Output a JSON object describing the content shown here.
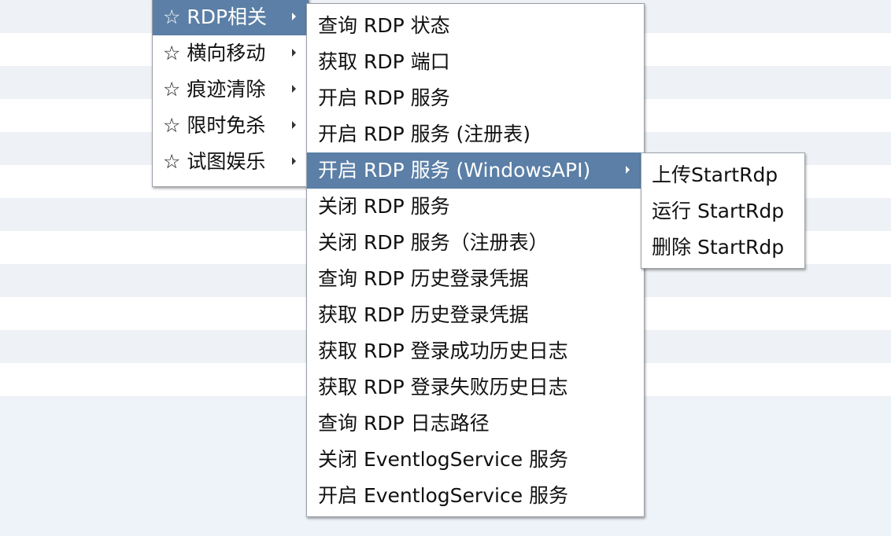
{
  "main_menu": {
    "items": [
      {
        "label": "☆ RDP相关",
        "selected": true
      },
      {
        "label": "☆ 横向移动"
      },
      {
        "label": "☆ 痕迹清除"
      },
      {
        "label": "☆ 限时免杀"
      },
      {
        "label": "☆ 试图娱乐"
      }
    ]
  },
  "rdp_menu": {
    "items": [
      {
        "label": "查询 RDP 状态"
      },
      {
        "label": "获取 RDP 端口"
      },
      {
        "label": "开启 RDP 服务"
      },
      {
        "label": "开启 RDP 服务 (注册表)"
      },
      {
        "label": "开启 RDP 服务 (WindowsAPI)",
        "selected": true
      },
      {
        "label": "关闭 RDP 服务"
      },
      {
        "label": "关闭 RDP 服务（注册表）"
      },
      {
        "label": "查询 RDP 历史登录凭据"
      },
      {
        "label": "获取 RDP 历史登录凭据"
      },
      {
        "label": "获取 RDP 登录成功历史日志"
      },
      {
        "label": "获取 RDP 登录失败历史日志"
      },
      {
        "label": "查询 RDP 日志路径"
      },
      {
        "label": "关闭 EventlogService 服务"
      },
      {
        "label": "开启 EventlogService 服务"
      }
    ]
  },
  "startrdp_menu": {
    "items": [
      {
        "label": "上传StartRdp"
      },
      {
        "label": "运行 StartRdp"
      },
      {
        "label": "删除 StartRdp"
      }
    ]
  },
  "colors": {
    "selection": "#5b7fa6",
    "stripe": "#eef1f5",
    "bottom_panel": "#eef2f9"
  },
  "icons": {
    "submenu_arrow": "triangle-right-icon"
  }
}
